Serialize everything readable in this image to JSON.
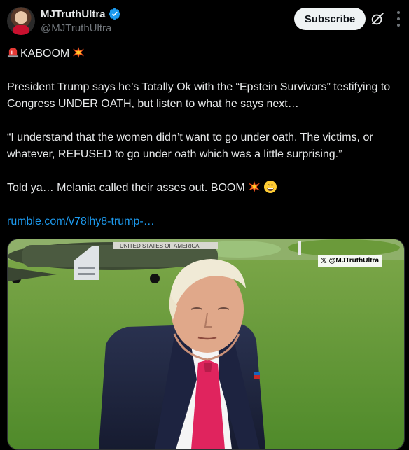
{
  "author": {
    "display_name": "MJTruthUltra",
    "handle": "@MJTruthUltra",
    "verified": true
  },
  "actions": {
    "subscribe_label": "Subscribe"
  },
  "tweet": {
    "line1": "KABOOM",
    "line2": "President Trump says he’s Totally Ok with the “Epstein Survivors” testifying to Congress UNDER OATH, but listen to what he says next…",
    "line3": "“I understand that the women didn’t want to go under oath. The victims, or whatever, REFUSED to go under oath which was a little surprising.”",
    "line4": "Told ya… Melania called their asses out. BOOM",
    "link": "rumble.com/v78lhy8-trump-…"
  },
  "media": {
    "watermark": "@MJTruthUltra",
    "aircraft_lettering": "UNITED STATES OF AMERICA"
  },
  "colors": {
    "background": "#000000",
    "text": "#e7e9ea",
    "secondary": "#71767b",
    "link": "#1d9bf0",
    "verified": "#1d9bf0",
    "tie": "#e0245e"
  },
  "icons": [
    "verified-badge-icon",
    "grok-icon",
    "more-icon",
    "siren-emoji",
    "collision-emoji",
    "grin-emoji",
    "x-logo-icon"
  ]
}
